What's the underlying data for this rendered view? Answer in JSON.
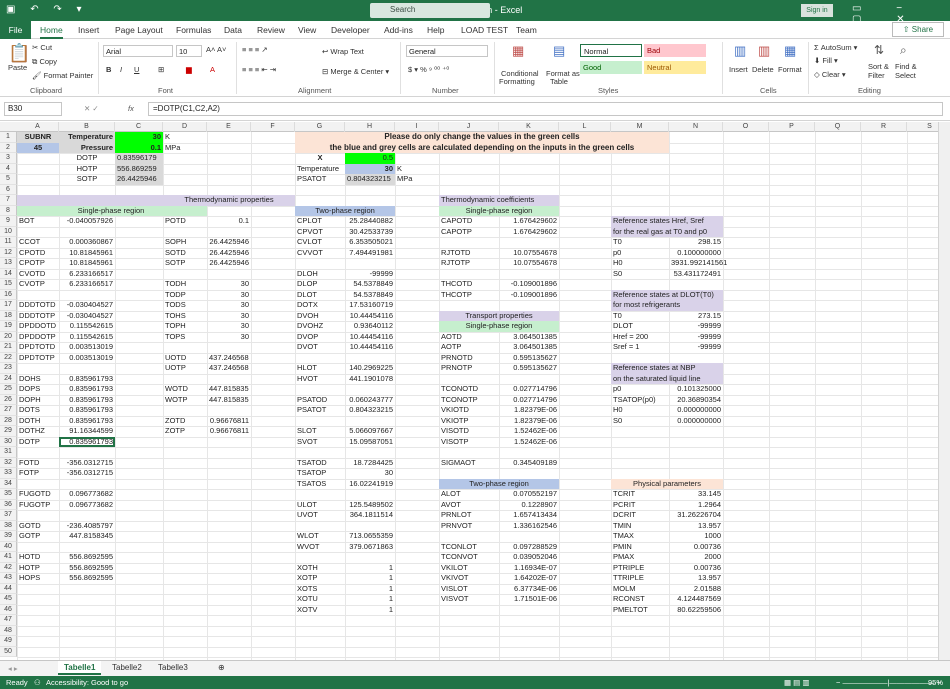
{
  "window": {
    "title": "FLUIDCAL.xlsm - Excel",
    "search_placeholder": "Search",
    "sign_in": "Sign in"
  },
  "ribbon_tabs": [
    "File",
    "Home",
    "Insert",
    "Page Layout",
    "Formulas",
    "Data",
    "Review",
    "View",
    "Developer",
    "Add-ins",
    "Help",
    "LOAD TEST",
    "Team"
  ],
  "share_label": "Share",
  "ribbon": {
    "paste": "Paste",
    "cut": "Cut",
    "copy": "Copy",
    "format_painter": "Format Painter",
    "clipboard": "Clipboard",
    "font_name": "Arial",
    "font_size": "10",
    "font_group": "Font",
    "wrap_text": "Wrap Text",
    "merge_center": "Merge & Center",
    "alignment": "Alignment",
    "number_format": "General",
    "number": "Number",
    "conditional": "Conditional",
    "formatting": "Formatting",
    "format_as": "Format as",
    "table": "Table",
    "style_normal": "Normal",
    "style_bad": "Bad",
    "style_good": "Good",
    "style_neutral": "Neutral",
    "styles": "Styles",
    "insert": "Insert",
    "delete": "Delete",
    "format": "Format",
    "cells": "Cells",
    "autosum": "AutoSum",
    "fill": "Fill",
    "clear": "Clear",
    "sort_filter": "Sort &",
    "filter": "Filter",
    "find_select": "Find &",
    "select": "Select",
    "editing": "Editing"
  },
  "formula_bar": {
    "name_box": "B30",
    "formula": "=DOTP(C1,C2,A2)",
    "fx": "fx"
  },
  "columns": [
    "A",
    "B",
    "C",
    "D",
    "E",
    "F",
    "G",
    "H",
    "I",
    "J",
    "K",
    "L",
    "M",
    "N",
    "O",
    "P",
    "Q",
    "R",
    "S"
  ],
  "cells": [
    [
      "A1",
      "SUBNR",
      "ctr b"
    ],
    [
      "B1",
      "Temperature",
      "r b"
    ],
    [
      "C1",
      "30",
      "r b"
    ],
    [
      "D1",
      "K",
      ""
    ],
    [
      "G1",
      "Please do only change the values in the green cells",
      "ctr b"
    ],
    [
      "A2",
      "45",
      "ctr b"
    ],
    [
      "B2",
      "Pressure",
      "r b"
    ],
    [
      "C2",
      "0.1",
      "r b"
    ],
    [
      "D2",
      "MPa",
      ""
    ],
    [
      "G2",
      "the blue and grey cells are calculated depending on the inputs in the green cells",
      "ctr b"
    ],
    [
      "B3",
      "DOTP",
      "ctr"
    ],
    [
      "C3",
      "0.83596179",
      ""
    ],
    [
      "G3",
      "X",
      "ctr b"
    ],
    [
      "H3",
      "0.5",
      "r"
    ],
    [
      "B4",
      "HOTP",
      "ctr"
    ],
    [
      "C4",
      "556.869259",
      ""
    ],
    [
      "G4",
      "Temperature",
      ""
    ],
    [
      "H4",
      "30",
      "r b"
    ],
    [
      "I4",
      "K",
      ""
    ],
    [
      "B5",
      "SOTP",
      "ctr"
    ],
    [
      "C5",
      "26.4425946",
      ""
    ],
    [
      "G5",
      "PSATOT",
      ""
    ],
    [
      "H5",
      "0.804323215",
      ""
    ],
    [
      "I5",
      "MPa",
      ""
    ],
    [
      "D7",
      "Thermodynamic properties",
      "ctr"
    ],
    [
      "J7",
      "Thermodynamic coefficients",
      ""
    ],
    [
      "B8",
      "Single-phase region",
      "ctr"
    ],
    [
      "G8",
      "Two-phase region",
      "ctr"
    ],
    [
      "J8",
      "Single-phase region",
      "ctr"
    ],
    [
      "A9",
      "BOT",
      ""
    ],
    [
      "B9",
      "-0.040057926",
      "r"
    ],
    [
      "D9",
      "POTD",
      ""
    ],
    [
      "E9",
      "0.1",
      "r"
    ],
    [
      "G9",
      "CPLOT",
      ""
    ],
    [
      "H9",
      "25.28440882",
      "r"
    ],
    [
      "J9",
      "CAPOTD",
      ""
    ],
    [
      "K9",
      "1.676429602",
      "r"
    ],
    [
      "G10",
      "CPVOT",
      ""
    ],
    [
      "H10",
      "30.42533739",
      "r"
    ],
    [
      "J10",
      "CAPOTP",
      ""
    ],
    [
      "K10",
      "1.676429602",
      "r"
    ],
    [
      "A11",
      "CCOT",
      ""
    ],
    [
      "B11",
      "0.000360867",
      "r"
    ],
    [
      "D11",
      "SOPH",
      ""
    ],
    [
      "E11",
      "26.4425946",
      "r"
    ],
    [
      "G11",
      "CVLOT",
      ""
    ],
    [
      "H11",
      "6.353505021",
      "r"
    ],
    [
      "A12",
      "CPOTD",
      ""
    ],
    [
      "B12",
      "10.81845961",
      "r"
    ],
    [
      "D12",
      "SOTD",
      ""
    ],
    [
      "E12",
      "26.4425946",
      "r"
    ],
    [
      "G12",
      "CVVOT",
      ""
    ],
    [
      "H12",
      "7.494491981",
      "r"
    ],
    [
      "J12",
      "RJTOTD",
      ""
    ],
    [
      "K12",
      "10.07554678",
      "r"
    ],
    [
      "A13",
      "CPOTP",
      ""
    ],
    [
      "B13",
      "10.81845961",
      "r"
    ],
    [
      "D13",
      "SOTP",
      ""
    ],
    [
      "E13",
      "26.4425946",
      "r"
    ],
    [
      "J13",
      "RJTOTP",
      ""
    ],
    [
      "K13",
      "10.07554678",
      "r"
    ],
    [
      "A14",
      "CVOTD",
      ""
    ],
    [
      "B14",
      "6.233166517",
      "r"
    ],
    [
      "G14",
      "DLOH",
      ""
    ],
    [
      "H14",
      "-99999",
      "r"
    ],
    [
      "A15",
      "CVOTP",
      ""
    ],
    [
      "B15",
      "6.233166517",
      "r"
    ],
    [
      "D15",
      "TODH",
      ""
    ],
    [
      "E15",
      "30",
      "r"
    ],
    [
      "G15",
      "DLOP",
      ""
    ],
    [
      "H15",
      "54.5378849",
      "r"
    ],
    [
      "J15",
      "THCOTD",
      ""
    ],
    [
      "K15",
      "-0.109001896",
      "r"
    ],
    [
      "D16",
      "TODP",
      ""
    ],
    [
      "E16",
      "30",
      "r"
    ],
    [
      "G16",
      "DLOT",
      ""
    ],
    [
      "H16",
      "54.5378849",
      "r"
    ],
    [
      "J16",
      "THCOTP",
      ""
    ],
    [
      "K16",
      "-0.109001896",
      "r"
    ],
    [
      "A17",
      "DDDTOTD",
      ""
    ],
    [
      "B17",
      "-0.030404527",
      "r"
    ],
    [
      "D17",
      "TODS",
      ""
    ],
    [
      "E17",
      "30",
      "r"
    ],
    [
      "G17",
      "DOTX",
      ""
    ],
    [
      "H17",
      "17.53160719",
      "r"
    ],
    [
      "A18",
      "DDDTOTP",
      ""
    ],
    [
      "B18",
      "-0.030404527",
      "r"
    ],
    [
      "D18",
      "TOHS",
      ""
    ],
    [
      "E18",
      "30",
      "r"
    ],
    [
      "G18",
      "DVOH",
      ""
    ],
    [
      "H18",
      "10.44454116",
      "r"
    ],
    [
      "J18",
      "Transport properties",
      "ctr"
    ],
    [
      "A19",
      "DPDDOTD",
      ""
    ],
    [
      "B19",
      "0.115542615",
      "r"
    ],
    [
      "D19",
      "TOPH",
      ""
    ],
    [
      "E19",
      "30",
      "r"
    ],
    [
      "G19",
      "DVOHZ",
      ""
    ],
    [
      "H19",
      "0.93640112",
      "r"
    ],
    [
      "J19",
      "Single-phase region",
      "ctr"
    ],
    [
      "A20",
      "DPDDOTP",
      ""
    ],
    [
      "B20",
      "0.115542615",
      "r"
    ],
    [
      "D20",
      "TOPS",
      ""
    ],
    [
      "E20",
      "30",
      "r"
    ],
    [
      "G20",
      "DVOP",
      ""
    ],
    [
      "H20",
      "10.44454116",
      "r"
    ],
    [
      "J20",
      "AOTD",
      ""
    ],
    [
      "K20",
      "3.064501385",
      "r"
    ],
    [
      "A21",
      "DPDTOTD",
      ""
    ],
    [
      "B21",
      "0.003513019",
      "r"
    ],
    [
      "G21",
      "DVOT",
      ""
    ],
    [
      "H21",
      "10.44454116",
      "r"
    ],
    [
      "J21",
      "AOTP",
      ""
    ],
    [
      "K21",
      "3.064501385",
      "r"
    ],
    [
      "A22",
      "DPDTOTP",
      ""
    ],
    [
      "B22",
      "0.003513019",
      "r"
    ],
    [
      "D22",
      "UOTD",
      ""
    ],
    [
      "E22",
      "437.246568",
      ""
    ],
    [
      "J22",
      "PRNOTD",
      ""
    ],
    [
      "K22",
      "0.595135627",
      "r"
    ],
    [
      "D23",
      "UOTP",
      ""
    ],
    [
      "E23",
      "437.246568",
      ""
    ],
    [
      "G23",
      "HLOT",
      ""
    ],
    [
      "H23",
      "140.2969225",
      "r"
    ],
    [
      "J23",
      "PRNOTP",
      ""
    ],
    [
      "K23",
      "0.595135627",
      "r"
    ],
    [
      "A24",
      "DOHS",
      ""
    ],
    [
      "B24",
      "0.835961793",
      "r"
    ],
    [
      "G24",
      "HVOT",
      ""
    ],
    [
      "H24",
      "441.1901078",
      "r"
    ],
    [
      "A25",
      "DOPS",
      ""
    ],
    [
      "B25",
      "0.835961793",
      "r"
    ],
    [
      "D25",
      "WOTD",
      ""
    ],
    [
      "E25",
      "447.815835",
      ""
    ],
    [
      "J25",
      "TCONOTD",
      ""
    ],
    [
      "K25",
      "0.027714796",
      "r"
    ],
    [
      "A26",
      "DOPH",
      ""
    ],
    [
      "B26",
      "0.835961793",
      "r"
    ],
    [
      "D26",
      "WOTP",
      ""
    ],
    [
      "E26",
      "447.815835",
      ""
    ],
    [
      "G26",
      "PSATOD",
      ""
    ],
    [
      "H26",
      "0.060243777",
      "r"
    ],
    [
      "J26",
      "TCONOTP",
      ""
    ],
    [
      "K26",
      "0.027714796",
      "r"
    ],
    [
      "A27",
      "DOTS",
      ""
    ],
    [
      "B27",
      "0.835961793",
      "r"
    ],
    [
      "G27",
      "PSATOT",
      ""
    ],
    [
      "H27",
      "0.804323215",
      "r"
    ],
    [
      "J27",
      "VKIOTD",
      ""
    ],
    [
      "K27",
      "1.82379E-06",
      "r"
    ],
    [
      "A28",
      "DOTH",
      ""
    ],
    [
      "B28",
      "0.835961793",
      "r"
    ],
    [
      "D28",
      "ZOTD",
      ""
    ],
    [
      "E28",
      "0.96676811",
      "r"
    ],
    [
      "J28",
      "VKIOTP",
      ""
    ],
    [
      "K28",
      "1.82379E-06",
      "r"
    ],
    [
      "A29",
      "DOTHZ",
      ""
    ],
    [
      "B29",
      "91.16344599",
      "r"
    ],
    [
      "D29",
      "ZOTP",
      ""
    ],
    [
      "E29",
      "0.96676811",
      "r"
    ],
    [
      "G29",
      "SLOT",
      ""
    ],
    [
      "H29",
      "5.066097667",
      "r"
    ],
    [
      "J29",
      "VISOTD",
      ""
    ],
    [
      "K29",
      "1.52462E-06",
      "r"
    ],
    [
      "A30",
      "DOTP",
      ""
    ],
    [
      "B30",
      "0.835961793",
      "r"
    ],
    [
      "G30",
      "SVOT",
      ""
    ],
    [
      "H30",
      "15.09587051",
      "r"
    ],
    [
      "J30",
      "VISOTP",
      ""
    ],
    [
      "K30",
      "1.52462E-06",
      "r"
    ],
    [
      "A32",
      "FOTD",
      ""
    ],
    [
      "B32",
      "-356.0312715",
      "r"
    ],
    [
      "G32",
      "TSATOD",
      ""
    ],
    [
      "H32",
      "18.7284425",
      "r"
    ],
    [
      "J32",
      "SIGMAOT",
      ""
    ],
    [
      "K32",
      "0.345409189",
      "r"
    ],
    [
      "A33",
      "FOTP",
      ""
    ],
    [
      "B33",
      "-356.0312715",
      "r"
    ],
    [
      "G33",
      "TSATOP",
      ""
    ],
    [
      "H33",
      "30",
      "r"
    ],
    [
      "G34",
      "TSATOS",
      ""
    ],
    [
      "H34",
      "16.02241919",
      "r"
    ],
    [
      "J34",
      "Two-phase region",
      "ctr"
    ],
    [
      "M34",
      "Physical parameters",
      "ctr"
    ],
    [
      "A35",
      "FUGOTD",
      ""
    ],
    [
      "B35",
      "0.096773682",
      "r"
    ],
    [
      "J35",
      "ALOT",
      ""
    ],
    [
      "K35",
      "0.070552197",
      "r"
    ],
    [
      "M35",
      "TCRIT",
      ""
    ],
    [
      "N35",
      "33.145",
      "r"
    ],
    [
      "A36",
      "FUGOTP",
      ""
    ],
    [
      "B36",
      "0.096773682",
      "r"
    ],
    [
      "G36",
      "ULOT",
      ""
    ],
    [
      "H36",
      "125.5489502",
      "r"
    ],
    [
      "J36",
      "AVOT",
      ""
    ],
    [
      "K36",
      "0.1228907",
      "r"
    ],
    [
      "M36",
      "PCRIT",
      ""
    ],
    [
      "N36",
      "1.2964",
      "r"
    ],
    [
      "G37",
      "UVOT",
      ""
    ],
    [
      "H37",
      "364.1811514",
      "r"
    ],
    [
      "J37",
      "PRNLOT",
      ""
    ],
    [
      "K37",
      "1.657413434",
      "r"
    ],
    [
      "M37",
      "DCRIT",
      ""
    ],
    [
      "N37",
      "31.26226704",
      "r"
    ],
    [
      "A38",
      "GOTD",
      ""
    ],
    [
      "B38",
      "-236.4085797",
      "r"
    ],
    [
      "J38",
      "PRNVOT",
      ""
    ],
    [
      "K38",
      "1.336162546",
      "r"
    ],
    [
      "M38",
      "TMIN",
      ""
    ],
    [
      "N38",
      "13.957",
      "r"
    ],
    [
      "A39",
      "GOTP",
      ""
    ],
    [
      "B39",
      "447.8158345",
      "r"
    ],
    [
      "G39",
      "WLOT",
      ""
    ],
    [
      "H39",
      "713.0655359",
      "r"
    ],
    [
      "M39",
      "TMAX",
      ""
    ],
    [
      "N39",
      "1000",
      "r"
    ],
    [
      "G40",
      "WVOT",
      ""
    ],
    [
      "H40",
      "379.0671863",
      "r"
    ],
    [
      "J40",
      "TCONLOT",
      ""
    ],
    [
      "K40",
      "0.097288529",
      "r"
    ],
    [
      "M40",
      "PMIN",
      ""
    ],
    [
      "N40",
      "0.00736",
      "r"
    ],
    [
      "A41",
      "HOTD",
      ""
    ],
    [
      "B41",
      "556.8692595",
      "r"
    ],
    [
      "J41",
      "TCONVOT",
      ""
    ],
    [
      "K41",
      "0.039052046",
      "r"
    ],
    [
      "M41",
      "PMAX",
      ""
    ],
    [
      "N41",
      "2000",
      "r"
    ],
    [
      "A42",
      "HOTP",
      ""
    ],
    [
      "B42",
      "556.8692595",
      "r"
    ],
    [
      "G42",
      "XOTH",
      ""
    ],
    [
      "H42",
      "1",
      "r"
    ],
    [
      "J42",
      "VKILOT",
      ""
    ],
    [
      "K42",
      "1.16934E-07",
      "r"
    ],
    [
      "M42",
      "PTRIPLE",
      ""
    ],
    [
      "N42",
      "0.00736",
      "r"
    ],
    [
      "A43",
      "HOPS",
      ""
    ],
    [
      "B43",
      "556.8692595",
      "r"
    ],
    [
      "G43",
      "XOTP",
      ""
    ],
    [
      "H43",
      "1",
      "r"
    ],
    [
      "J43",
      "VKIVOT",
      ""
    ],
    [
      "K43",
      "1.64202E-07",
      "r"
    ],
    [
      "M43",
      "TTRIPLE",
      ""
    ],
    [
      "N43",
      "13.957",
      "r"
    ],
    [
      "G44",
      "XOTS",
      ""
    ],
    [
      "H44",
      "1",
      "r"
    ],
    [
      "J44",
      "VISLOT",
      ""
    ],
    [
      "K44",
      "6.37734E-06",
      "r"
    ],
    [
      "M44",
      "MOLM",
      ""
    ],
    [
      "N44",
      "2.01588",
      "r"
    ],
    [
      "G45",
      "XOTU",
      ""
    ],
    [
      "H45",
      "1",
      "r"
    ],
    [
      "J45",
      "VISVOT",
      ""
    ],
    [
      "K45",
      "1.71501E-06",
      "r"
    ],
    [
      "M45",
      "RCONST",
      ""
    ],
    [
      "N45",
      "4.124487569",
      "r"
    ],
    [
      "G46",
      "XOTV",
      ""
    ],
    [
      "H46",
      "1",
      "r"
    ],
    [
      "M46",
      "PMELTOT",
      ""
    ],
    [
      "N46",
      "80.62259506",
      "r"
    ],
    [
      "M9",
      "Reference states Href, Sref",
      ""
    ],
    [
      "M10",
      "for the real gas at T0 and p0",
      ""
    ],
    [
      "M11",
      "T0",
      ""
    ],
    [
      "N11",
      "298.15",
      "r"
    ],
    [
      "M12",
      "p0",
      ""
    ],
    [
      "N12",
      "0.100000000",
      "r"
    ],
    [
      "M13",
      "H0",
      ""
    ],
    [
      "N13",
      "3931.992141561",
      "r"
    ],
    [
      "M14",
      "S0",
      ""
    ],
    [
      "N14",
      "53.431172491",
      "r"
    ],
    [
      "M16",
      "Reference states at DLOT(T0)",
      ""
    ],
    [
      "M17",
      "for most refrigerants",
      ""
    ],
    [
      "M18",
      "T0",
      ""
    ],
    [
      "N18",
      "273.15",
      "r"
    ],
    [
      "M19",
      "DLOT",
      ""
    ],
    [
      "N19",
      "-99999",
      "r"
    ],
    [
      "M20",
      "Href = 200",
      ""
    ],
    [
      "N20",
      "-99999",
      "r"
    ],
    [
      "M21",
      "Sref = 1",
      ""
    ],
    [
      "N21",
      "-99999",
      "r"
    ],
    [
      "M23",
      "Reference states at NBP",
      ""
    ],
    [
      "M24",
      "on the saturated liquid line",
      ""
    ],
    [
      "M25",
      "p0",
      ""
    ],
    [
      "N25",
      "0.101325000",
      "r"
    ],
    [
      "M26",
      "TSATOP(p0)",
      ""
    ],
    [
      "N26",
      "20.36890354",
      "r"
    ],
    [
      "M27",
      "H0",
      ""
    ],
    [
      "N27",
      "0.000000000",
      "r"
    ],
    [
      "M28",
      "S0",
      ""
    ],
    [
      "N28",
      "0.000000000",
      "r"
    ]
  ],
  "sheets": [
    "Tabelle1",
    "Tabelle2",
    "Tabelle3"
  ],
  "status": {
    "ready": "Ready",
    "accessibility": "Accessibility: Good to go",
    "zoom": "95%"
  },
  "colors": {
    "green": "#00ff00",
    "blue": "#b4c6e7",
    "grey": "#d9d9d9",
    "peach": "#fce4d6",
    "purple": "#d9d2e9",
    "lightgreen": "#c6efce",
    "excel": "#217346"
  }
}
